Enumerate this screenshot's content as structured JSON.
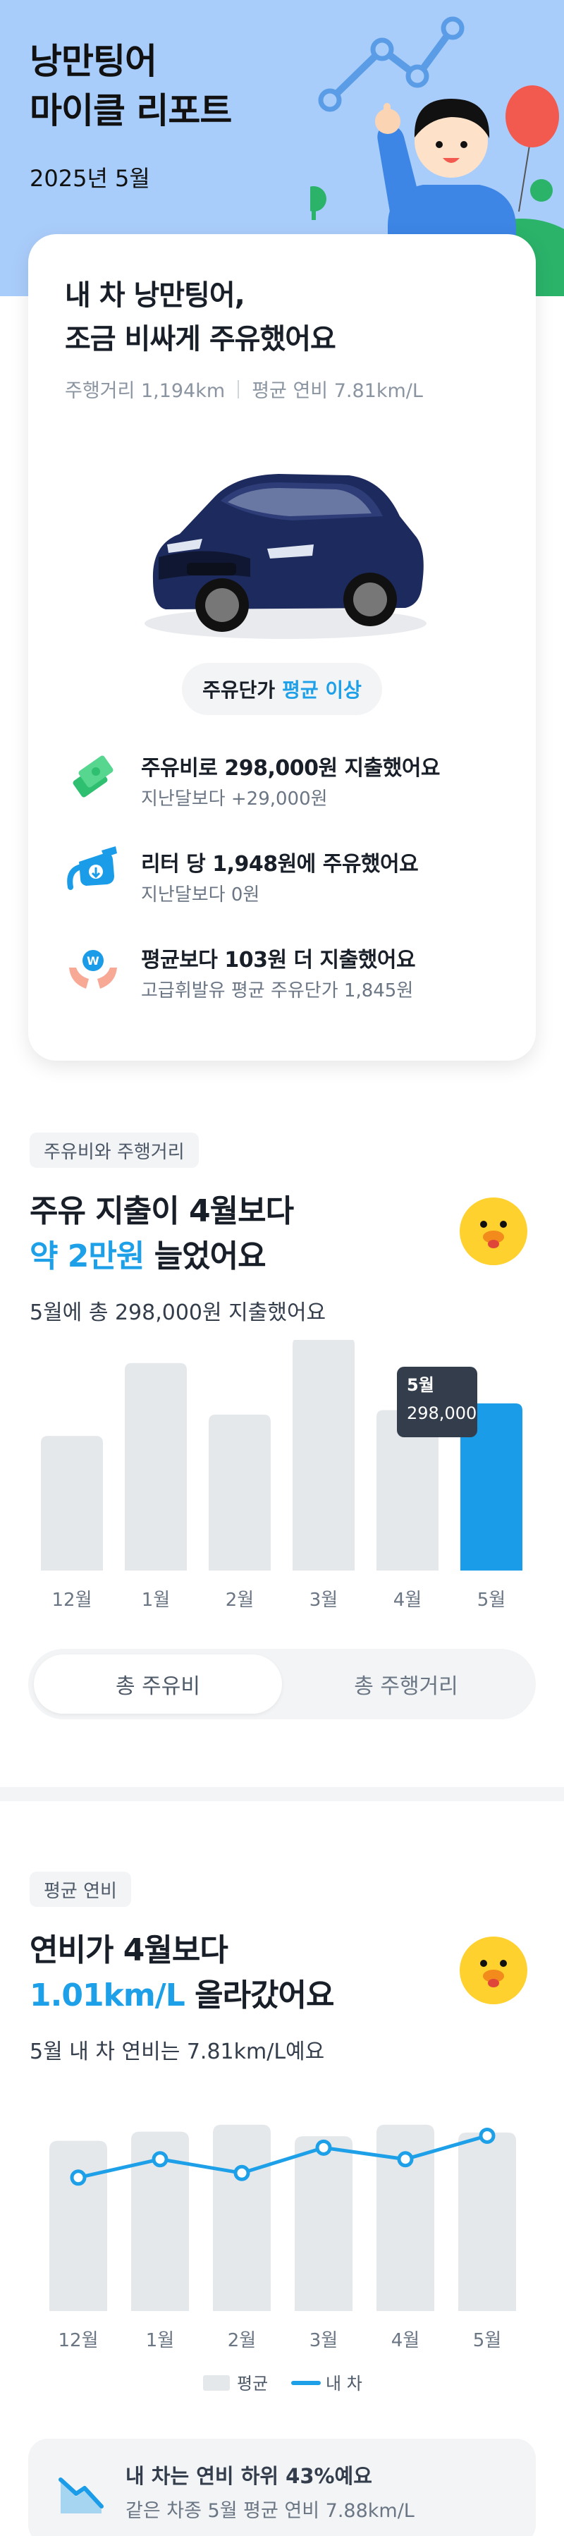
{
  "hero": {
    "title_line1": "낭만팅어",
    "title_line2": "마이클 리포트",
    "date": "2025년 5월"
  },
  "report": {
    "headline_line1": "내 차 낭만팅어,",
    "headline_line2": "조금 비싸게 주유했어요",
    "distance": "주행거리 1,194km",
    "efficiency": "평균 연비 7.81km/L",
    "price_badge_prefix": "주유단가",
    "price_badge_accent": "평균 이상",
    "items": [
      {
        "icon": "money-icon",
        "title": "주유비로 298,000원 지출했어요",
        "sub": "지난달보다 +29,000원"
      },
      {
        "icon": "fuel-nozzle-icon",
        "title": "리터 당 1,948원에 주유했어요",
        "sub": "지난달보다 0원"
      },
      {
        "icon": "coin-hands-icon",
        "title": "평균보다 103원 더 지출했어요",
        "sub": "고급휘발유 평균 주유단가 1,845원"
      }
    ]
  },
  "spending": {
    "tag": "주유비와 주행거리",
    "title_line1": "주유 지출이 4월보다",
    "title_accent": "약 2만원",
    "title_rest": " 늘었어요",
    "subtitle": "5월에 총 298,000원 지출했어요",
    "tooltip_month": "5월",
    "tooltip_value": "298,000",
    "toggle": [
      "총 주유비",
      "총 주행거리"
    ],
    "toggle_selected": 0
  },
  "efficiency_section": {
    "tag": "평균 연비",
    "title_line1": "연비가 4월보다",
    "title_accent": "1.01km/L",
    "title_rest": " 올라갔어요",
    "subtitle": "5월 내 차 연비는 7.81km/L예요",
    "legend_avg": "평균",
    "legend_mine": "내 차"
  },
  "insight": {
    "title": "내 차는 연비 하위 43%예요",
    "sub": "같은 차종 5월 평균 연비 7.88km/L"
  },
  "colors": {
    "accent": "#1ea0e8",
    "bar_grey": "#e5e8eb",
    "bar_active": "#1a9ce8",
    "hero_bg": "#a9cdfb"
  },
  "chart_data": [
    {
      "type": "bar",
      "categories": [
        "12월",
        "1월",
        "2월",
        "3월",
        "4월",
        "5월"
      ],
      "values": [
        240000,
        370000,
        278000,
        415000,
        286000,
        298000
      ],
      "highlight_index": 5,
      "xlabel": "",
      "ylabel": "",
      "ylim": [
        0,
        420000
      ],
      "grid": false
    },
    {
      "type": "line",
      "categories": [
        "12월",
        "1월",
        "2월",
        "3월",
        "4월",
        "5월"
      ],
      "series": [
        {
          "name": "평균",
          "style": "bar",
          "values": [
            7.7,
            7.9,
            8.05,
            7.8,
            8.05,
            7.88
          ]
        },
        {
          "name": "내 차",
          "style": "line",
          "values": [
            6.9,
            7.3,
            7.0,
            7.55,
            7.3,
            7.81
          ]
        }
      ],
      "xlabel": "",
      "ylabel": "",
      "ylim": [
        4.0,
        8.2
      ],
      "grid": false,
      "legend": "bottom"
    }
  ]
}
